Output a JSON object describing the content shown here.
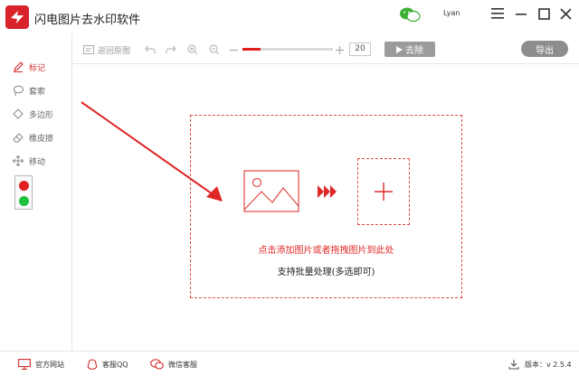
{
  "app": {
    "title": "闪电图片去水印软件",
    "user": "Lyan"
  },
  "toolbar": {
    "back_original_label": "返回原图",
    "zoom_value": "20",
    "zoom_progress": 0.2,
    "remove_label": "去除",
    "export_label": "导出"
  },
  "sidebar": {
    "tools": [
      {
        "label": "标记",
        "icon": "pen-icon",
        "active": true
      },
      {
        "label": "套索",
        "icon": "lasso-icon",
        "active": false
      },
      {
        "label": "多边形",
        "icon": "polygon-icon",
        "active": false
      },
      {
        "label": "橡皮擦",
        "icon": "eraser-icon",
        "active": false
      },
      {
        "label": "移动",
        "icon": "move-icon",
        "active": false
      }
    ],
    "colors": [
      "#e02020",
      "#22c040"
    ]
  },
  "dropzone": {
    "hint_primary": "点击添加图片或者拖拽图片到此处",
    "hint_secondary": "支持批量处理(多选即可)"
  },
  "footer": {
    "website_label": "官方网站",
    "qq_label": "客服QQ",
    "wechat_label": "微信客服",
    "version_label": "版本：v 2.5.4"
  },
  "theme": {
    "accent": "#e02020"
  }
}
